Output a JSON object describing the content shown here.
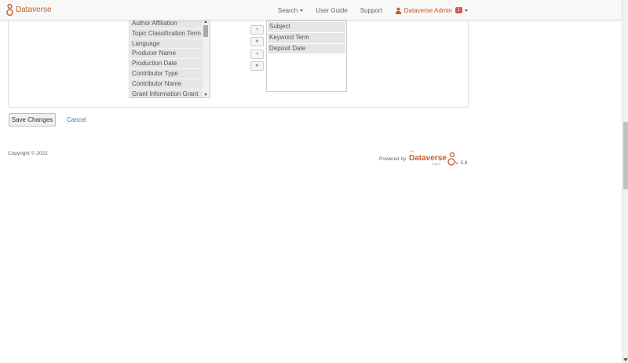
{
  "navbar": {
    "brand": "Dataverse",
    "search": "Search",
    "user_guide": "User Guide",
    "support": "Support",
    "user_name": "Dataverse Admin",
    "notification_count": "1"
  },
  "left_list": {
    "items": [
      "Author Affiliation",
      "Topic Classification Term",
      "Language",
      "Producer Name",
      "Production Date",
      "Contributor Type",
      "Contributor Name",
      "Grant Information Grant"
    ]
  },
  "move_buttons": {
    "add_one": "›",
    "add_all": "»",
    "remove_one": "‹",
    "remove_all": "«"
  },
  "right_list": {
    "items": [
      "Subject",
      "Keyword Term",
      "Deposit Date"
    ]
  },
  "actions": {
    "save": "Save Changes",
    "cancel": "Cancel"
  },
  "footer": {
    "copyright": "Copyright © 2022",
    "powered_by": "Powered by",
    "logo_the": "The",
    "logo_name": "Dataverse",
    "logo_project": "Project",
    "version": "v. 5.8"
  },
  "colors": {
    "brand": "#c55b28",
    "link": "#337ab7",
    "badge": "#d9534f"
  }
}
